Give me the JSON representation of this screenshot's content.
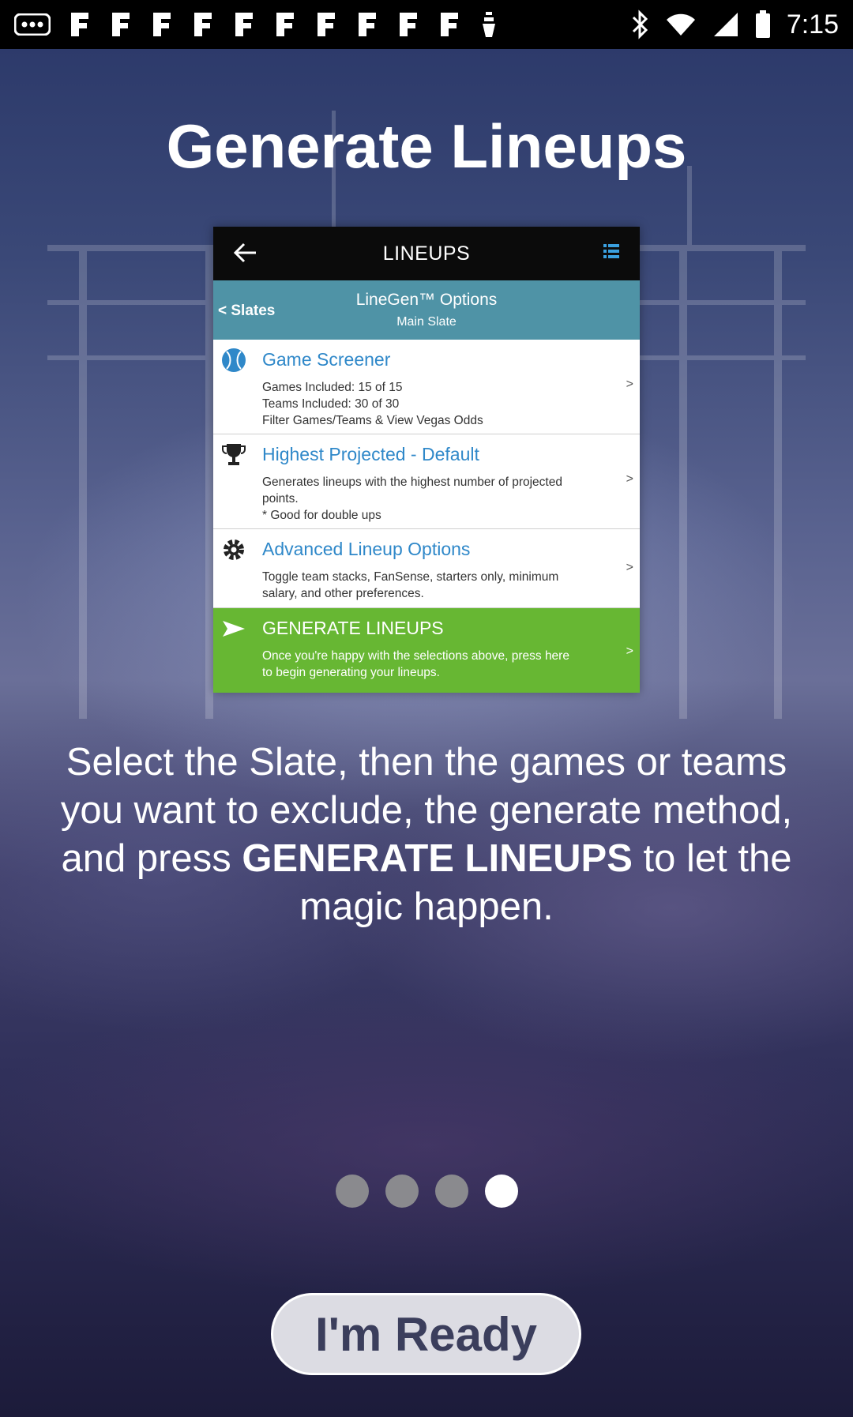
{
  "status_bar": {
    "time": "7:15",
    "left_icons": [
      "more-dots-icon",
      "fantasy-app-icon",
      "fantasy-app-icon",
      "fantasy-app-icon",
      "fantasy-app-icon",
      "fantasy-app-icon",
      "fantasy-app-icon",
      "fantasy-app-icon",
      "fantasy-app-icon",
      "fantasy-app-icon",
      "fantasy-app-icon",
      "download-icon"
    ],
    "right_icons": [
      "bluetooth-icon",
      "wifi-icon",
      "signal-icon",
      "battery-icon"
    ]
  },
  "page": {
    "title": "Generate Lineups",
    "description_before": "Select the Slate, then the games or teams you want to exclude, the generate method, and press ",
    "description_bold": "GENERATE LINEUPS",
    "description_after": " to let the magic happen.",
    "ready_button": "I'm Ready"
  },
  "pager": {
    "total": 4,
    "active_index": 3
  },
  "screenshot": {
    "topbar_title": "LINEUPS",
    "back_label": "< Slates",
    "options_title": "LineGen™ Options",
    "options_subtitle": "Main Slate",
    "rows": [
      {
        "title": "Game Screener",
        "lines": [
          "Games Included: 15 of 15",
          "Teams Included: 30 of 30",
          "Filter Games/Teams & View Vegas Odds"
        ],
        "chevron": ">",
        "icon": "baseball-icon"
      },
      {
        "title": "Highest Projected - Default",
        "lines": [
          "Generates lineups with the highest number of projected",
          "points.",
          "* Good for double ups"
        ],
        "chevron": ">",
        "icon": "trophy-icon"
      },
      {
        "title": "Advanced Lineup Options",
        "lines": [
          "Toggle team stacks, FanSense, starters only, minimum",
          "salary, and other preferences."
        ],
        "chevron": ">",
        "icon": "gear-icon"
      },
      {
        "title": "GENERATE LINEUPS",
        "lines": [
          "Once you're happy with the selections above, press here",
          "to begin generating your lineups."
        ],
        "chevron": ">",
        "icon": "send-icon"
      }
    ]
  },
  "colors": {
    "status_bar": "#000000",
    "screenshot_header": "#4f93a6",
    "link_blue": "#2f88c9",
    "generate_green": "#67b733",
    "button_bg": "#dcdce3",
    "button_text": "#3b3e5c"
  }
}
